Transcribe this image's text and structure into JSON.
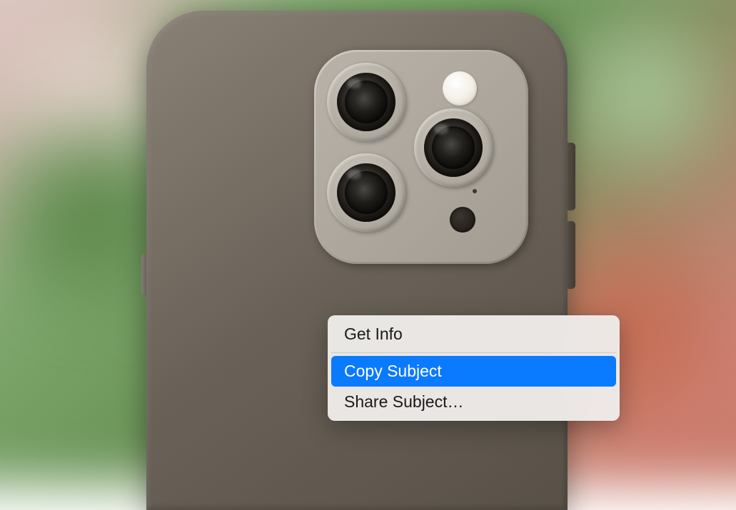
{
  "context_menu": {
    "items": [
      {
        "label": "Get Info",
        "highlighted": false
      },
      {
        "label": "Copy Subject",
        "highlighted": true
      },
      {
        "label": "Share Subject…",
        "highlighted": false
      }
    ]
  },
  "colors": {
    "menu_highlight": "#0a7aff",
    "menu_bg": "rgba(238,236,234,0.96)"
  }
}
